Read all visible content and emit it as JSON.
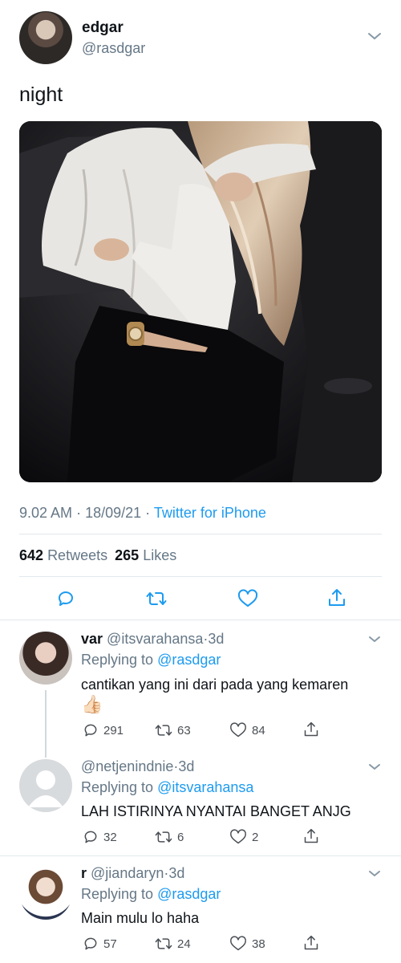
{
  "tweet": {
    "display_name": "edgar",
    "handle": "@rasdgar",
    "text": "night",
    "time": "9.02 AM",
    "date": "18/09/21",
    "source": "Twitter for iPhone",
    "retweets_count": "642",
    "retweets_label": "Retweets",
    "likes_count": "265",
    "likes_label": "Likes"
  },
  "replies": [
    {
      "name": "var",
      "handle": "@itsvarahansa",
      "time": "3d",
      "replying_prefix": "Replying to",
      "replying_to": "@rasdgar",
      "text": "cantikan yang ini dari pada yang kemaren",
      "emoji": "👍🏻",
      "replies": "291",
      "retweets": "63",
      "likes": "84"
    },
    {
      "name": "",
      "handle": "@netjenindnie",
      "time": "3d",
      "replying_prefix": "Replying to",
      "replying_to": "@itsvarahansa",
      "text": "LAH ISTIRINYA NYANTAI BANGET ANJG",
      "replies": "32",
      "retweets": "6",
      "likes": "2"
    },
    {
      "name": "r",
      "handle": "@jiandaryn",
      "time": "3d",
      "replying_prefix": "Replying to",
      "replying_to": "@rasdgar",
      "text": "Main mulu lo haha",
      "replies": "57",
      "retweets": "24",
      "likes": "38"
    }
  ],
  "icons": {
    "reply": "reply-icon",
    "retweet": "retweet-icon",
    "like": "heart-icon",
    "share": "share-icon",
    "more": "chevron-down-icon"
  },
  "colors": {
    "accent": "#1d9bf0",
    "muted": "#657786",
    "divider": "#e1e8ed"
  }
}
